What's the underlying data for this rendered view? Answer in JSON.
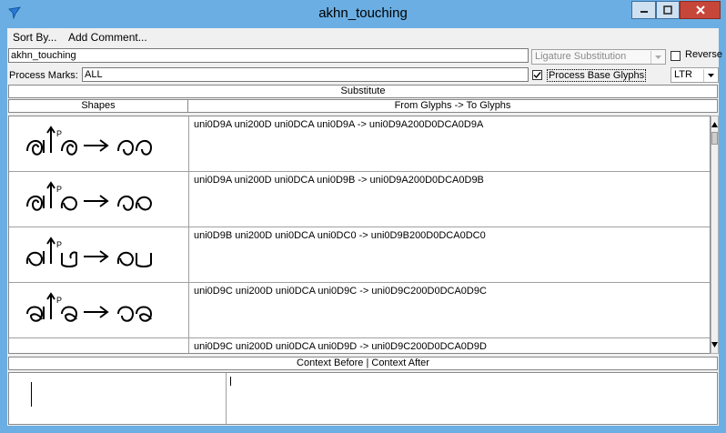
{
  "window": {
    "title": "akhn_touching",
    "accent": "#6aaee3"
  },
  "menu": {
    "items": [
      "Sort By...",
      "Add Comment..."
    ]
  },
  "form": {
    "name_value": "akhn_touching",
    "process_marks_label": "Process Marks:",
    "process_marks_value": "ALL",
    "lookup_type": "Ligature Substitution",
    "reverse_label": "Reverse",
    "process_base_label": "Process Base Glyphs",
    "process_base_checked": true,
    "direction": "LTR"
  },
  "substitute": {
    "section_label": "Substitute",
    "col_shapes": "Shapes",
    "col_glyphs": "From Glyphs -> To Glyphs",
    "rows": [
      {
        "text": "uni0D9A uni200D uni0DCA uni0D9A -> uni0D9A200D0DCA0D9A"
      },
      {
        "text": "uni0D9A uni200D uni0DCA uni0D9B -> uni0D9A200D0DCA0D9B"
      },
      {
        "text": "uni0D9B uni200D uni0DCA uni0DC0 -> uni0D9B200D0DCA0DC0"
      },
      {
        "text": "uni0D9C uni200D uni0DCA uni0D9C -> uni0D9C200D0DCA0D9C"
      },
      {
        "text": "uni0D9C uni200D uni0DCA uni0D9D -> uni0D9C200D0DCA0D9D"
      }
    ]
  },
  "context": {
    "label": "Context Before | Context After"
  }
}
